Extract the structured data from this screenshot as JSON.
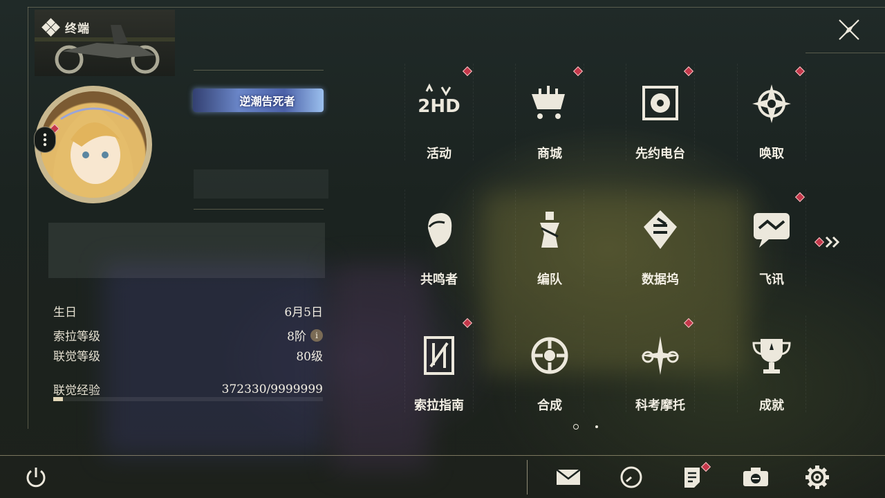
{
  "header": {
    "title": "终端",
    "brand_icon": "diamond-cluster-icon",
    "close_icon": "close-icon"
  },
  "profile": {
    "title_badge": "逆潮告死者",
    "more_icon": "more-dots-icon",
    "stats": [
      {
        "label": "生日",
        "value": "6月5日"
      },
      {
        "label": "索拉等级",
        "value": "8阶",
        "info_icon": "info-icon",
        "info_glyph": "i"
      },
      {
        "label": "联觉等级",
        "value": "80级"
      }
    ],
    "exp_label": "联觉经验",
    "exp_value": "372330/9999999",
    "exp_fraction": 0.037
  },
  "menu": {
    "items": [
      {
        "label": "活动",
        "icon": "event-2hd-icon",
        "badge": true
      },
      {
        "label": "商城",
        "icon": "shop-cart-icon",
        "badge": true
      },
      {
        "label": "先约电台",
        "icon": "radio-icon",
        "badge": true
      },
      {
        "label": "唤取",
        "icon": "convene-compass-icon",
        "badge": true
      },
      {
        "label": "共鸣者",
        "icon": "resonator-head-icon",
        "badge": false
      },
      {
        "label": "编队",
        "icon": "team-chess-icon",
        "badge": false
      },
      {
        "label": "数据坞",
        "icon": "data-bank-icon",
        "badge": false
      },
      {
        "label": "飞讯",
        "icon": "message-chat-icon",
        "badge": true
      },
      {
        "label": "索拉指南",
        "icon": "guidebook-icon",
        "badge": true
      },
      {
        "label": "合成",
        "icon": "synthesis-icon",
        "badge": false
      },
      {
        "label": "科考摩托",
        "icon": "motorbike-icon",
        "badge": true
      },
      {
        "label": "成就",
        "icon": "trophy-icon",
        "badge": false
      }
    ],
    "next_page_icon": "double-chevron-right-icon",
    "page_count": 2,
    "current_page": 1
  },
  "footer": {
    "buttons": [
      {
        "name": "power",
        "icon": "power-icon"
      },
      {
        "name": "mail",
        "icon": "mail-icon"
      },
      {
        "name": "clock",
        "icon": "clock-icon"
      },
      {
        "name": "notice",
        "icon": "notice-document-icon",
        "badge": true
      },
      {
        "name": "photo",
        "icon": "camera-icon"
      },
      {
        "name": "settings",
        "icon": "gear-icon"
      }
    ]
  },
  "colors": {
    "accent": "#c4374a",
    "text": "#ece8dc",
    "gold": "#c9b88f"
  }
}
